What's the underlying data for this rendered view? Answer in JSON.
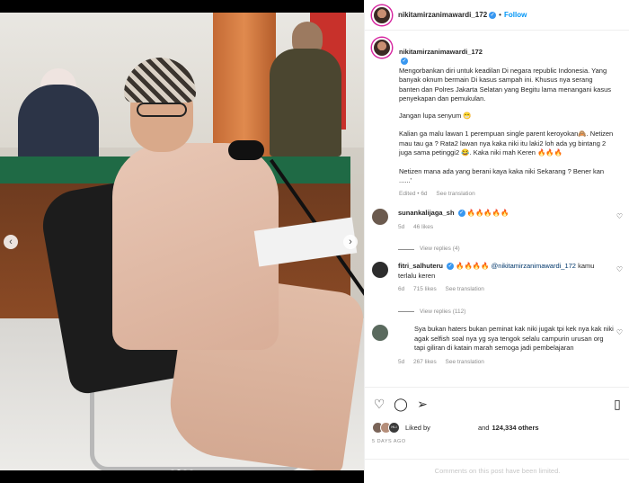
{
  "post": {
    "username": "nikitamirzanimawardi_172",
    "follow_label": "Follow",
    "separator": "•"
  },
  "caption": {
    "username": "nikitamirzanimawardi_172",
    "paragraphs": [
      "Mengorbankan diri untuk keadilan Di negara republic Indonesia. Yang banyak oknum bermain Di kasus sampah ini. Khusus nya serang banten dan Polres Jakarta Selatan yang Begitu lama menangani kasus penyekapan dan pemukulan.",
      "Jangan lupa senyum 😁",
      "Kalian ga malu lawan 1 perempuan single parent keroyokan🙈. Netizen mau tau ga ? Rata2 lawan nya kaka niki itu laki2 loh ada yg bintang 2 juga sama petinggi2 😂. Kaka niki mah Keren 🔥🔥🔥",
      "Netizen mana ada yang berani kaya kaka niki Sekarang ? Bener kan ......'"
    ],
    "edited": "Edited • 6d",
    "see_translation": "See translation"
  },
  "comments": [
    {
      "username": "sunankalijaga_sh",
      "text": "🔥🔥🔥🔥🔥",
      "age": "5d",
      "likes": "46 likes",
      "replies": "View replies (4)",
      "avatar_color": "#6b5a4e"
    },
    {
      "username": "fitri_salhuteru",
      "text": "🔥🔥🔥🔥",
      "mention": "@nikitamirzanimawardi_172",
      "text_after": " kamu terlalu keren",
      "age": "6d",
      "likes": "715 likes",
      "see_translation": "See translation",
      "replies": "View replies (112)",
      "avatar_color": "#2d2d2d"
    },
    {
      "username": "",
      "text": "Sya bukan haters bukan peminat kak niki jugak tpi kek nya kak niki agak selfish soal nya yg sya tengok selalu campurin urusan org tapi giliran di katain marah semoga jadi pembelajaran",
      "age": "5d",
      "likes": "267 likes",
      "see_translation": "See translation",
      "avatar_color": "#5a6a5e"
    }
  ],
  "actions": {
    "liked_by_prefix": "Liked by",
    "and_label": "and",
    "others_count": "124,334 others",
    "time_ago": "5 DAYS AGO",
    "mini_avatar_label": "HLI"
  },
  "footer": {
    "comments_limited": "Comments on this post have been limited."
  },
  "carousel": {
    "dot_count": 4,
    "active_index": 1
  },
  "colors": {
    "follow_blue": "#0095f6",
    "verified_blue": "#3897f0",
    "muted_gray": "#8e8e8e",
    "mention_blue": "#00376b"
  }
}
